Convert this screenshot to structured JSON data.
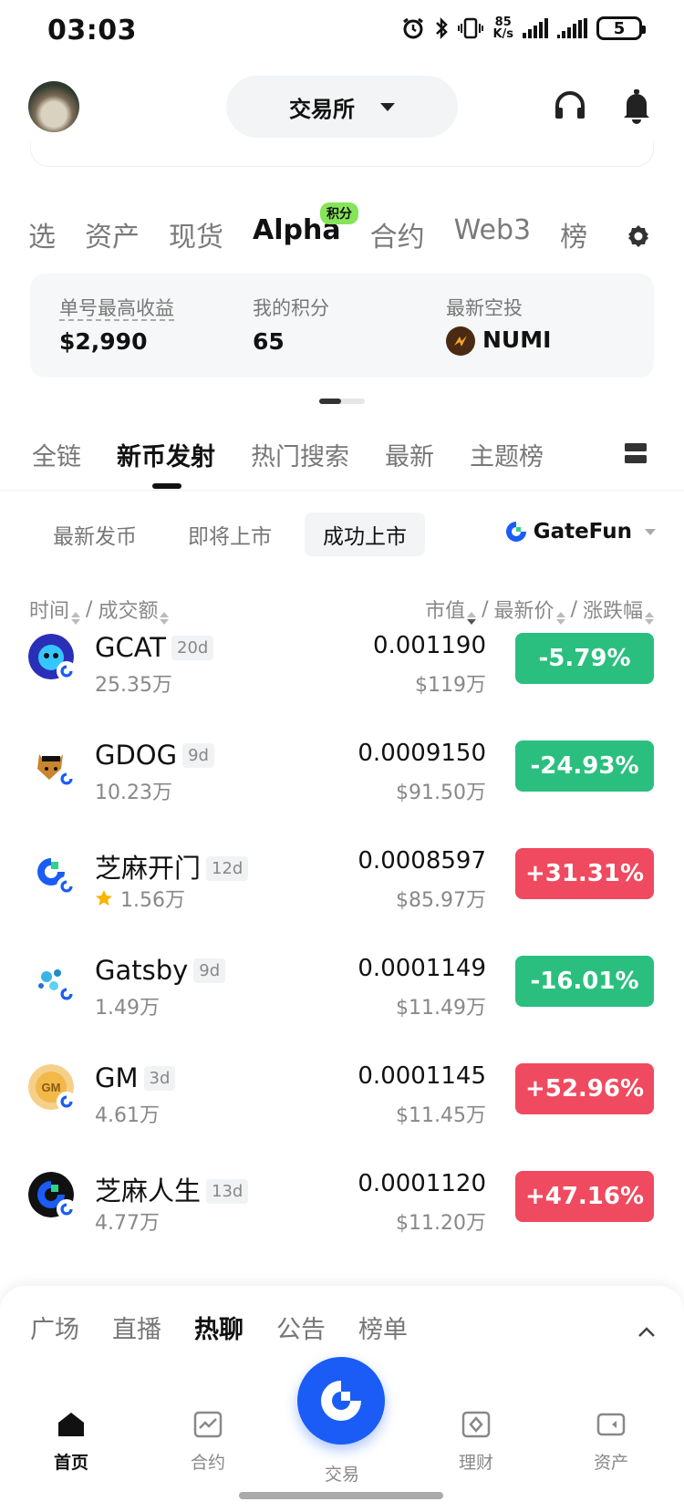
{
  "status_bar": {
    "time": "03:03",
    "net_speed_value": "85",
    "net_speed_unit": "K/s",
    "battery": "5"
  },
  "header": {
    "exchange_label": "交易所"
  },
  "primary_tabs": [
    "自选",
    "资产",
    "现货",
    "Alpha",
    "合约",
    "Web3",
    "榜单"
  ],
  "primary_tabs_display": [
    "选",
    "资产",
    "现货",
    "Alpha",
    "合约",
    "Web3",
    "榜"
  ],
  "alpha_badge": "积分",
  "stats": {
    "max_profit_label": "单号最高收益",
    "max_profit_value": "$2,990",
    "points_label": "我的积分",
    "points_value": "65",
    "airdrop_label": "最新空投",
    "airdrop_value": "NUMI"
  },
  "category_tabs": [
    "全链",
    "新币发射",
    "热门搜索",
    "最新",
    "主题榜"
  ],
  "filter_chips": [
    "最新发币",
    "即将上市",
    "成功上市"
  ],
  "platform": "GateFun",
  "columns": {
    "time": "时间",
    "volume": "成交额",
    "mcap": "市值",
    "price": "最新价",
    "change": "涨跌幅",
    "sep": "/"
  },
  "rows": [
    {
      "name": "GCAT",
      "age": "20d",
      "volume": "25.35万",
      "price": "0.001190",
      "mcap": "$119万",
      "change": "-5.79%",
      "dir": "down",
      "starred": false
    },
    {
      "name": "GDOG",
      "age": "9d",
      "volume": "10.23万",
      "price": "0.0009150",
      "mcap": "$91.50万",
      "change": "-24.93%",
      "dir": "down",
      "starred": false
    },
    {
      "name": "芝麻开门",
      "age": "12d",
      "volume": "1.56万",
      "price": "0.0008597",
      "mcap": "$85.97万",
      "change": "+31.31%",
      "dir": "up",
      "starred": true
    },
    {
      "name": "Gatsby",
      "age": "9d",
      "volume": "1.49万",
      "price": "0.0001149",
      "mcap": "$11.49万",
      "change": "-16.01%",
      "dir": "down",
      "starred": false
    },
    {
      "name": "GM",
      "age": "3d",
      "volume": "4.61万",
      "price": "0.0001145",
      "mcap": "$11.45万",
      "change": "+52.96%",
      "dir": "up",
      "starred": false
    },
    {
      "name": "芝麻人生",
      "age": "13d",
      "volume": "4.77万",
      "price": "0.0001120",
      "mcap": "$11.20万",
      "change": "+47.16%",
      "dir": "up",
      "starred": false
    }
  ],
  "social_tabs": [
    "广场",
    "直播",
    "热聊",
    "公告",
    "榜单"
  ],
  "bottom_nav": [
    "首页",
    "合约",
    "交易",
    "理财",
    "资产"
  ],
  "colors": {
    "up": "#ef4a5f",
    "down": "#2bbf7f",
    "brand": "#1a5cf5",
    "badge": "#86e45a"
  }
}
